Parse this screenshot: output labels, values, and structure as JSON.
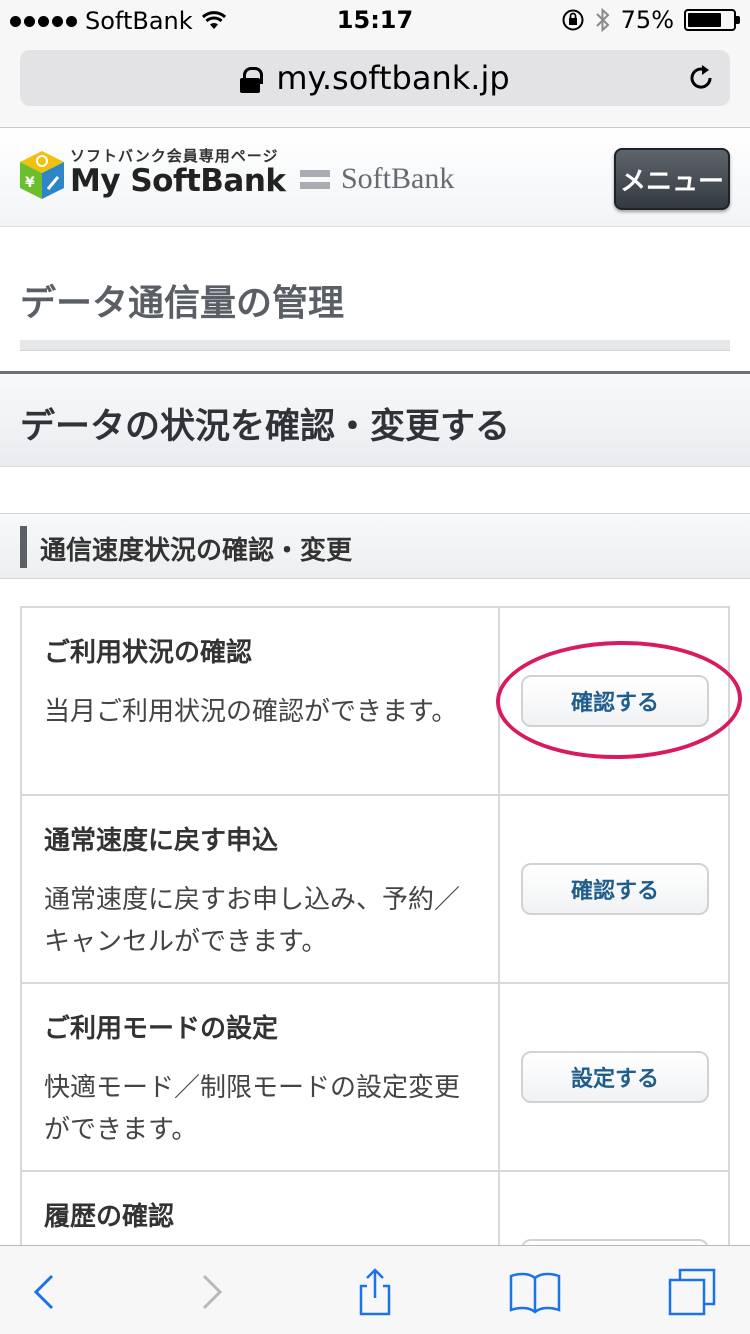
{
  "status_bar": {
    "carrier": "SoftBank",
    "time": "15:17",
    "battery": "75%",
    "battery_level": 0.75
  },
  "browser": {
    "url": "my.softbank.jp"
  },
  "header": {
    "logo_sub": "ソフトバンク会員専用ページ",
    "logo_main": "My SoftBank",
    "brand": "SoftBank",
    "menu_label": "メニュー"
  },
  "page": {
    "title": "データ通信量の管理",
    "section_title": "データの状況を確認・変更する",
    "subsection_title": "通信速度状況の確認・変更"
  },
  "rows": [
    {
      "title": "ご利用状況の確認",
      "desc": "当月ご利用状況の確認ができます。",
      "button": "確認する"
    },
    {
      "title": "通常速度に戻す申込",
      "desc": "通常速度に戻すお申し込み、予約／キャンセルができます。",
      "button": "確認する"
    },
    {
      "title": "ご利用モードの設定",
      "desc": "快適モード／制限モードの設定変更ができます。",
      "button": "設定する"
    },
    {
      "title": "履歴の確認",
      "desc": "",
      "button": ""
    }
  ],
  "icons": {
    "wifi": "wifi-icon",
    "lock": "lock-icon",
    "reload": "reload-icon",
    "back": "back-chevron-icon",
    "forward": "forward-chevron-icon",
    "share": "share-icon",
    "bookmarks": "bookmarks-icon",
    "tabs": "tabs-icon"
  },
  "colors": {
    "accent_ring": "#d81b60",
    "button_text": "#1f5d8c"
  }
}
